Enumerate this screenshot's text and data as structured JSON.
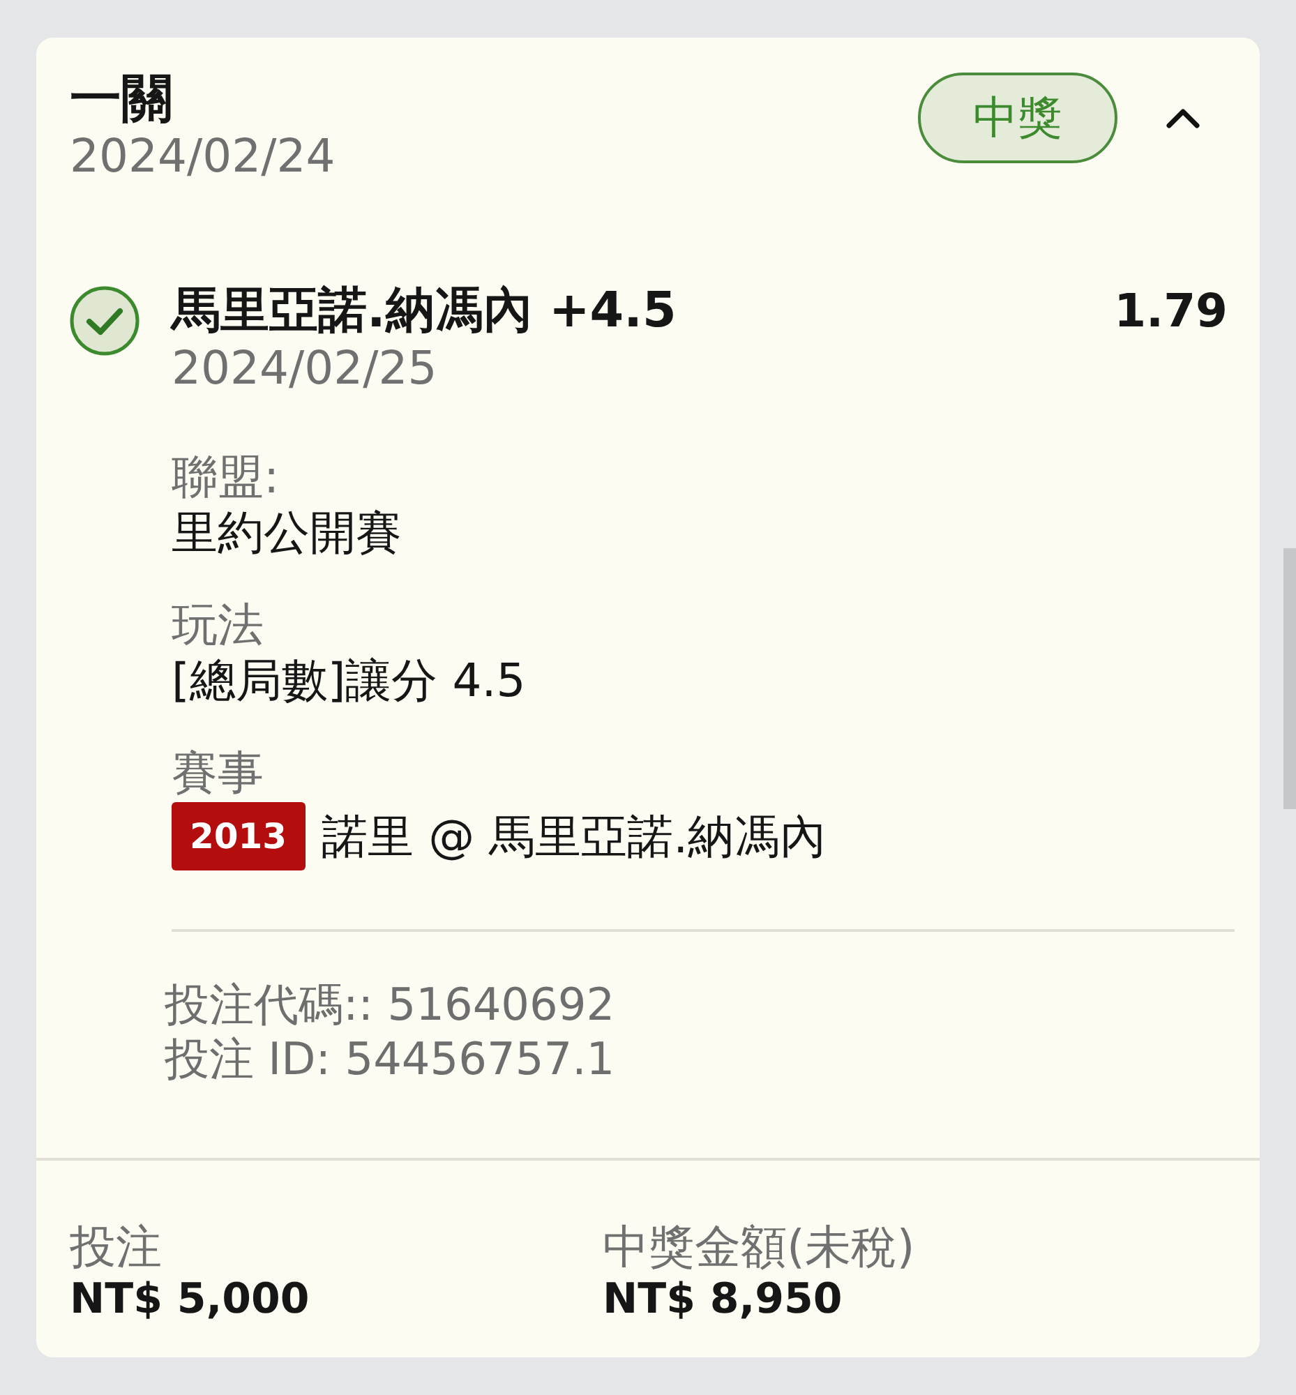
{
  "bet": {
    "type": "一關",
    "date": "2024/02/24",
    "status": {
      "label": "中獎",
      "won": true
    },
    "expanded": true
  },
  "selections": [
    {
      "won": true,
      "name": "馬里亞諾.納馮內 +4.5",
      "odds": "1.79",
      "date": "2024/02/25",
      "details": [
        {
          "label": "聯盟:",
          "value": "里約公開賽"
        },
        {
          "label": "玩法",
          "value": "[總局數]讓分 4.5"
        },
        {
          "label": "賽事",
          "tag": "2013",
          "value": "諾里 @ 馬里亞諾.納馮內"
        }
      ]
    }
  ],
  "codes": [
    "投注代碼:: 51640692",
    "投注 ID: 54456757.1"
  ],
  "summary": [
    {
      "label": "投注",
      "amount": "NT$ 5,000"
    },
    {
      "label": "中獎金額(未稅)",
      "amount": "NT$ 8,950"
    }
  ]
}
